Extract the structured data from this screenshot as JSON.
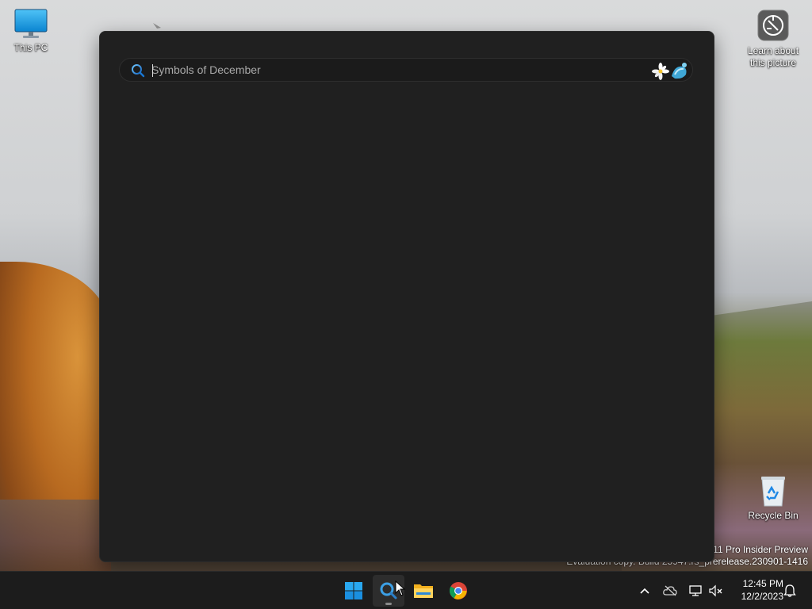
{
  "desktop": {
    "this_pc_label": "This PC",
    "learn_label_line1": "Learn about",
    "learn_label_line2": "this picture",
    "recycle_bin_label": "Recycle Bin"
  },
  "watermark": {
    "line1": "s 11 Pro Insider Preview",
    "line2": "Evaluation copy. Build 25947.rs_prerelease.230901-1416"
  },
  "search": {
    "placeholder": "Symbols of December",
    "value": "",
    "highlight_icon": "snowdrop-flower-icon"
  },
  "taskbar": {
    "apps": [
      {
        "name": "start",
        "icon": "windows-logo-icon"
      },
      {
        "name": "search",
        "icon": "search-icon",
        "active": true
      },
      {
        "name": "file-explorer",
        "icon": "folder-icon"
      },
      {
        "name": "chrome",
        "icon": "chrome-icon"
      }
    ],
    "tray": {
      "overflow_icon": "chevron-up-icon",
      "onedrive_icon": "cloud-offline-icon",
      "network_icon": "network-icon",
      "volume_icon": "volume-muted-icon",
      "notifications_icon": "bell-icon"
    },
    "time": "12:45 PM",
    "date": "12/2/2023"
  },
  "colors": {
    "panel_bg": "#202020",
    "taskbar_bg": "#1c1c1c",
    "accent_blue": "#0078d4"
  }
}
